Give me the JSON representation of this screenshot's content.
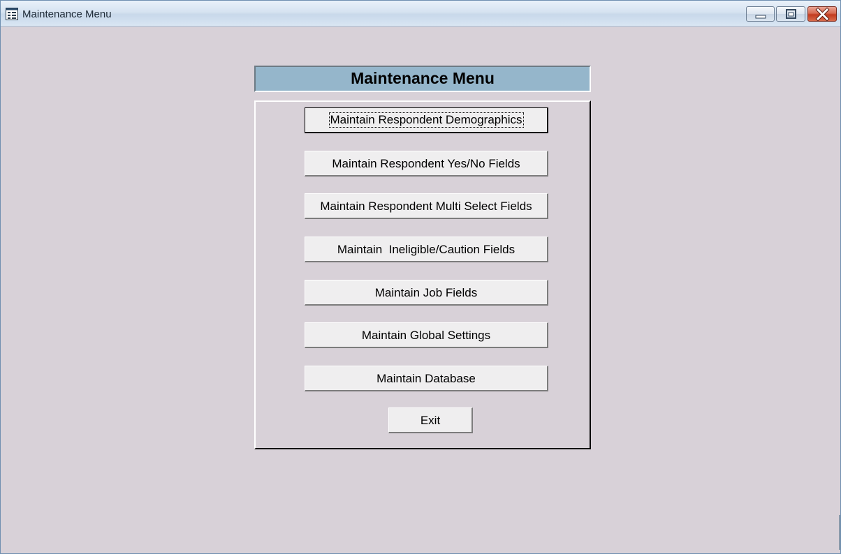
{
  "window": {
    "title": "Maintenance Menu",
    "icon": "form-icon",
    "controls": [
      "minimize-icon",
      "restore-icon",
      "close-icon"
    ]
  },
  "menu": {
    "heading": "Maintenance Menu",
    "buttons": [
      "Maintain Respondent Demographics",
      "Maintain Respondent Yes/No Fields",
      "Maintain Respondent Multi Select Fields",
      "Maintain  Ineligible/Caution Fields",
      "Maintain Job Fields",
      "Maintain Global Settings",
      "Maintain Database"
    ],
    "focused_button": "Maintain Respondent Demographics",
    "exit_label": "Exit"
  },
  "colors": {
    "background": "#d8d1d8",
    "heading_fill": "#95b6cb",
    "button_face": "#efeeef",
    "close_button": "#c23b1f"
  }
}
